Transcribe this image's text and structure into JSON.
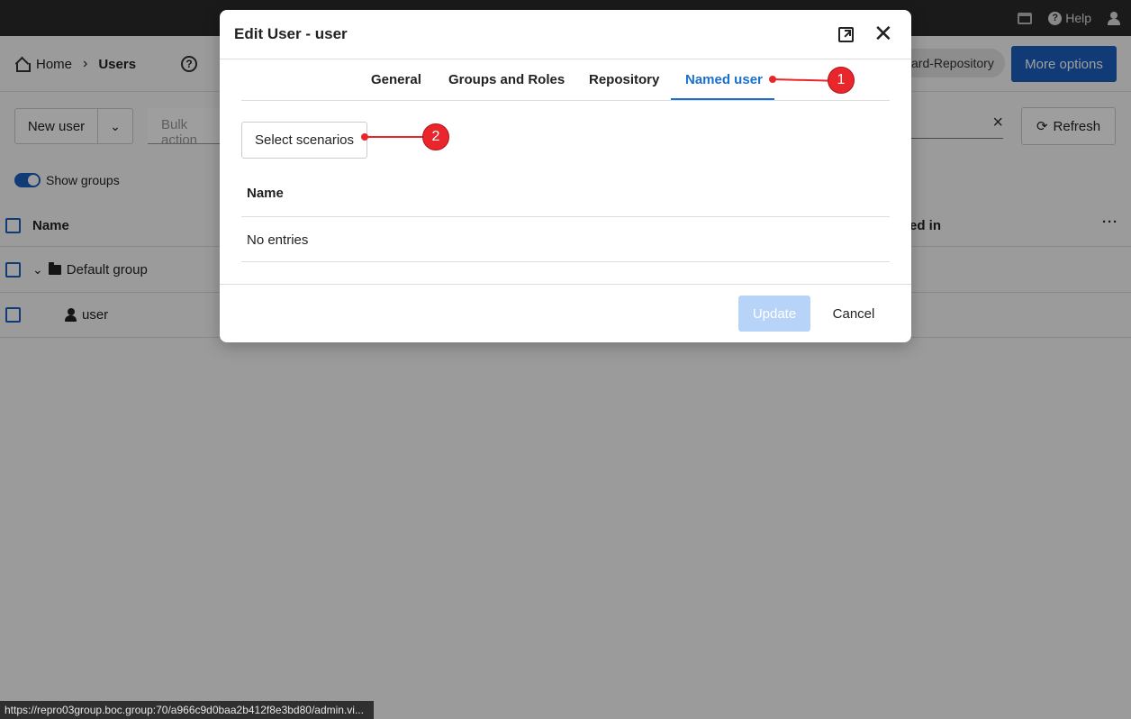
{
  "topbar": {
    "help_label": "Help",
    "icons": [
      "window-icon",
      "help-icon",
      "user-icon"
    ]
  },
  "page": {
    "breadcrumb": {
      "home": "Home",
      "separator": "›",
      "current": "Users"
    },
    "repository_pill": "ard-Repository",
    "more_options": "More options",
    "new_user": "New user",
    "bulk_placeholder": "Bulk action",
    "refresh": "Refresh",
    "show_groups": "Show groups",
    "columns": {
      "name": "Name",
      "logged_in": "ed in"
    },
    "rows": [
      {
        "label": "Default group",
        "type": "group"
      },
      {
        "label": "user",
        "type": "user"
      }
    ]
  },
  "modal": {
    "title": "Edit User - user",
    "tabs": [
      "General",
      "Groups and Roles",
      "Repository",
      "Named user"
    ],
    "active_tab": "Named user",
    "select_scenarios": "Select scenarios",
    "table_header": "Name",
    "empty_text": "No entries",
    "update": "Update",
    "cancel": "Cancel"
  },
  "annotations": {
    "badge1": "1",
    "badge2": "2",
    "color": "#e8262b"
  },
  "status_url": "https://repro03group.boc.group:70/a966c9d0baa2b412f8e3bd80/admin.vi...",
  "colors": {
    "primary": "#1a5fbf",
    "active_tab": "#1a6fd3",
    "update_disabled": "#b7d4f8"
  }
}
